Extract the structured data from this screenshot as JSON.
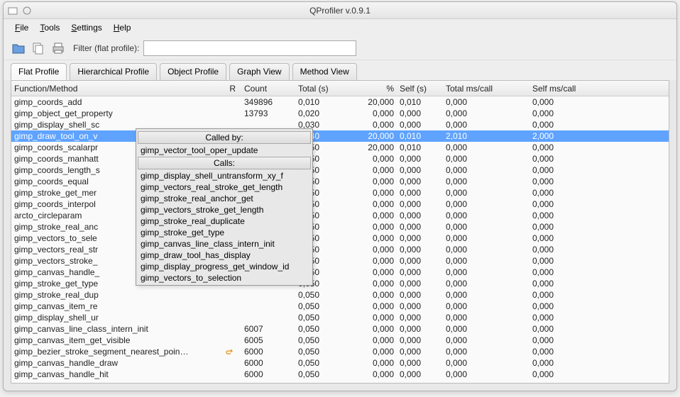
{
  "window": {
    "title": "QProfiler v.0.9.1"
  },
  "menu": {
    "file": "File",
    "tools": "Tools",
    "settings": "Settings",
    "help": "Help"
  },
  "toolbar": {
    "filter_label": "Filter (flat profile):",
    "filter_value": ""
  },
  "tabs": [
    "Flat Profile",
    "Hierarchical Profile",
    "Object Profile",
    "Graph View",
    "Method View"
  ],
  "active_tab": 0,
  "columns": [
    "Function/Method",
    "R",
    "Count",
    "Total (s)",
    "%",
    "Self (s)",
    "Total ms/call",
    "Self ms/call"
  ],
  "selected_row": 3,
  "rows": [
    {
      "fn": "gimp_coords_add",
      "r": "",
      "count": "349896",
      "total": "0,010",
      "pct": "20,000",
      "self": "0,010",
      "tpc": "0,000",
      "spc": "0,000"
    },
    {
      "fn": "gimp_object_get_property",
      "r": "",
      "count": "13793",
      "total": "0,020",
      "pct": "0,000",
      "self": "0,000",
      "tpc": "0,000",
      "spc": "0,000"
    },
    {
      "fn": "gimp_display_shell_sc",
      "r": "",
      "count": "",
      "total": "0,030",
      "pct": "0,000",
      "self": "0,000",
      "tpc": "0,000",
      "spc": "0,000"
    },
    {
      "fn": "gimp_draw_tool_on_v",
      "r": "",
      "count": "",
      "total": "0,040",
      "pct": "20,000",
      "self": "0,010",
      "tpc": "2,010",
      "spc": "2,000"
    },
    {
      "fn": "gimp_coords_scalarpr",
      "r": "",
      "count": "",
      "total": "0,050",
      "pct": "20,000",
      "self": "0,010",
      "tpc": "0,000",
      "spc": "0,000"
    },
    {
      "fn": "gimp_coords_manhatt",
      "r": "",
      "count": "",
      "total": "0,050",
      "pct": "0,000",
      "self": "0,000",
      "tpc": "0,000",
      "spc": "0,000"
    },
    {
      "fn": "gimp_coords_length_s",
      "r": "",
      "count": "",
      "total": "0,050",
      "pct": "0,000",
      "self": "0,000",
      "tpc": "0,000",
      "spc": "0,000"
    },
    {
      "fn": "gimp_coords_equal",
      "r": "",
      "count": "",
      "total": "0,050",
      "pct": "0,000",
      "self": "0,000",
      "tpc": "0,000",
      "spc": "0,000"
    },
    {
      "fn": "gimp_stroke_get_mer",
      "r": "",
      "count": "",
      "total": "0,050",
      "pct": "0,000",
      "self": "0,000",
      "tpc": "0,000",
      "spc": "0,000"
    },
    {
      "fn": "gimp_coords_interpol",
      "r": "",
      "count": "",
      "total": "0,050",
      "pct": "0,000",
      "self": "0,000",
      "tpc": "0,000",
      "spc": "0,000"
    },
    {
      "fn": "arcto_circleparam",
      "r": "",
      "count": "",
      "total": "0,050",
      "pct": "0,000",
      "self": "0,000",
      "tpc": "0,000",
      "spc": "0,000"
    },
    {
      "fn": "gimp_stroke_real_anc",
      "r": "",
      "count": "",
      "total": "0,050",
      "pct": "0,000",
      "self": "0,000",
      "tpc": "0,000",
      "spc": "0,000"
    },
    {
      "fn": "gimp_vectors_to_sele",
      "r": "",
      "count": "",
      "total": "0,050",
      "pct": "0,000",
      "self": "0,000",
      "tpc": "0,000",
      "spc": "0,000"
    },
    {
      "fn": "gimp_vectors_real_str",
      "r": "",
      "count": "",
      "total": "0,050",
      "pct": "0,000",
      "self": "0,000",
      "tpc": "0,000",
      "spc": "0,000"
    },
    {
      "fn": "gimp_vectors_stroke_",
      "r": "",
      "count": "",
      "total": "0,050",
      "pct": "0,000",
      "self": "0,000",
      "tpc": "0,000",
      "spc": "0,000"
    },
    {
      "fn": "gimp_canvas_handle_",
      "r": "",
      "count": "",
      "total": "0,050",
      "pct": "0,000",
      "self": "0,000",
      "tpc": "0,000",
      "spc": "0,000"
    },
    {
      "fn": "gimp_stroke_get_type",
      "r": "",
      "count": "",
      "total": "0,050",
      "pct": "0,000",
      "self": "0,000",
      "tpc": "0,000",
      "spc": "0,000"
    },
    {
      "fn": "gimp_stroke_real_dup",
      "r": "",
      "count": "",
      "total": "0,050",
      "pct": "0,000",
      "self": "0,000",
      "tpc": "0,000",
      "spc": "0,000"
    },
    {
      "fn": "gimp_canvas_item_re",
      "r": "",
      "count": "",
      "total": "0,050",
      "pct": "0,000",
      "self": "0,000",
      "tpc": "0,000",
      "spc": "0,000"
    },
    {
      "fn": "gimp_display_shell_ur",
      "r": "",
      "count": "",
      "total": "0,050",
      "pct": "0,000",
      "self": "0,000",
      "tpc": "0,000",
      "spc": "0,000"
    },
    {
      "fn": "gimp_canvas_line_class_intern_init",
      "r": "",
      "count": "6007",
      "total": "0,050",
      "pct": "0,000",
      "self": "0,000",
      "tpc": "0,000",
      "spc": "0,000"
    },
    {
      "fn": "gimp_canvas_item_get_visible",
      "r": "",
      "count": "6005",
      "total": "0,050",
      "pct": "0,000",
      "self": "0,000",
      "tpc": "0,000",
      "spc": "0,000"
    },
    {
      "fn": "gimp_bezier_stroke_segment_nearest_poin…",
      "r": "↻",
      "count": "6000",
      "total": "0,050",
      "pct": "0,000",
      "self": "0,000",
      "tpc": "0,000",
      "spc": "0,000"
    },
    {
      "fn": "gimp_canvas_handle_draw",
      "r": "",
      "count": "6000",
      "total": "0,050",
      "pct": "0,000",
      "self": "0,000",
      "tpc": "0,000",
      "spc": "0,000"
    },
    {
      "fn": "gimp_canvas_handle_hit",
      "r": "",
      "count": "6000",
      "total": "0,050",
      "pct": "0,000",
      "self": "0,000",
      "tpc": "0,000",
      "spc": "0,000"
    }
  ],
  "popup": {
    "called_by_label": "Called by:",
    "called_by": [
      "gimp_vector_tool_oper_update"
    ],
    "calls_label": "Calls:",
    "calls": [
      "gimp_display_shell_untransform_xy_f",
      "gimp_vectors_real_stroke_get_length",
      "gimp_stroke_real_anchor_get",
      "gimp_vectors_stroke_get_length",
      "gimp_stroke_real_duplicate",
      "gimp_stroke_get_type",
      "gimp_canvas_line_class_intern_init",
      "gimp_draw_tool_has_display",
      "gimp_display_progress_get_window_id",
      "gimp_vectors_to_selection"
    ]
  }
}
